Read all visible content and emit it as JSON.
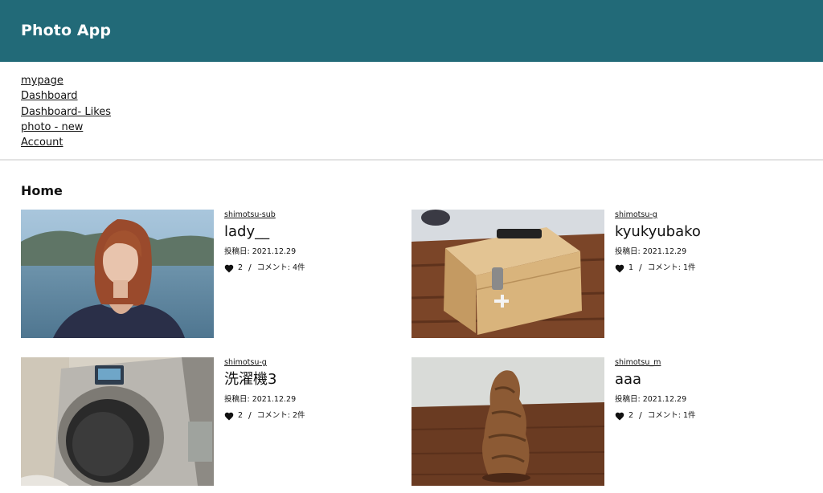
{
  "header": {
    "brand": "Photo App"
  },
  "nav": {
    "items": [
      "mypage",
      "Dashboard",
      "Dashboard- Likes",
      "photo - new",
      "Account"
    ]
  },
  "main": {
    "title": "Home"
  },
  "posts": [
    {
      "author": "shimotsu-sub",
      "title": "lady__",
      "date": "投稿日: 2021.12.29",
      "likes": "2",
      "separator": "/",
      "comments": "コメント: 4件"
    },
    {
      "author": "shimotsu-g",
      "title": "kyukyubako",
      "date": "投稿日: 2021.12.29",
      "likes": "1",
      "separator": "/",
      "comments": "コメント: 1件"
    },
    {
      "author": "shimotsu-g",
      "title": "洗濯機3",
      "date": "投稿日: 2021.12.29",
      "likes": "2",
      "separator": "/",
      "comments": "コメント: 2件"
    },
    {
      "author": "shimotsu_m",
      "title": "aaa",
      "date": "投稿日: 2021.12.29",
      "likes": "2",
      "separator": "/",
      "comments": "コメント: 1件"
    }
  ],
  "colors": {
    "header_bg": "#226a78",
    "header_text": "#ffffff",
    "divider": "#e3e3e3"
  },
  "icons": {
    "like": "heart-icon"
  }
}
